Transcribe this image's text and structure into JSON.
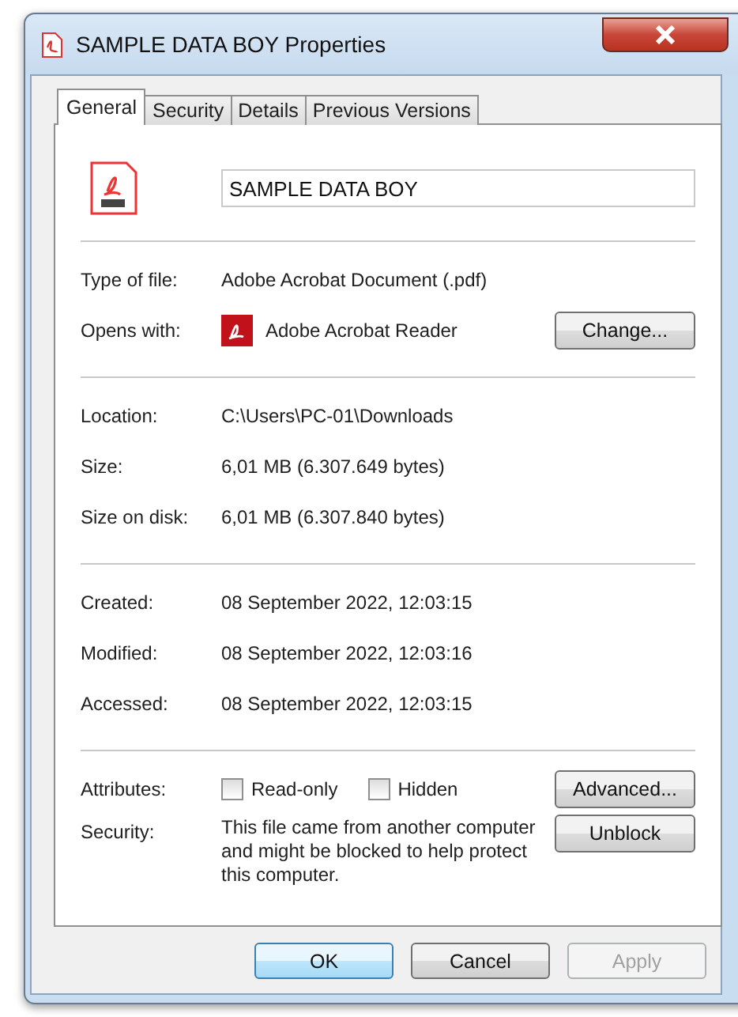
{
  "window": {
    "title": "SAMPLE DATA BOY Properties"
  },
  "tabs": [
    {
      "label": "General",
      "selected": true
    },
    {
      "label": "Security",
      "selected": false
    },
    {
      "label": "Details",
      "selected": false
    },
    {
      "label": "Previous Versions",
      "selected": false
    }
  ],
  "file_name": {
    "value": "SAMPLE DATA BOY"
  },
  "groups": [
    [
      {
        "kind": "text",
        "label": "Type of file:",
        "value": "Adobe Acrobat Document (.pdf)"
      },
      {
        "kind": "app",
        "label": "Opens with:",
        "value": "Adobe Acrobat Reader",
        "button": "Change..."
      }
    ],
    [
      {
        "kind": "text",
        "label": "Location:",
        "value": "C:\\Users\\PC-01\\Downloads"
      },
      {
        "kind": "text",
        "label": "Size:",
        "value": "6,01 MB (6.307.649 bytes)"
      },
      {
        "kind": "text",
        "label": "Size on disk:",
        "value": "6,01 MB (6.307.840 bytes)"
      }
    ],
    [
      {
        "kind": "text",
        "label": "Created:",
        "value": "08 September 2022, 12:03:15"
      },
      {
        "kind": "text",
        "label": "Modified:",
        "value": "08 September 2022, 12:03:16"
      },
      {
        "kind": "text",
        "label": "Accessed:",
        "value": "08 September 2022, 12:03:15"
      }
    ],
    [
      {
        "kind": "checkboxes",
        "label": "Attributes:",
        "options": [
          {
            "label": "Read-only",
            "checked": false
          },
          {
            "label": "Hidden",
            "checked": false
          }
        ],
        "button": "Advanced..."
      },
      {
        "kind": "note",
        "label": "Security:",
        "value": "This file came from another computer and might be blocked to help protect this computer.",
        "button": "Unblock"
      }
    ]
  ],
  "buttons": [
    {
      "label": "OK",
      "default": true,
      "disabled": false
    },
    {
      "label": "Cancel",
      "default": false,
      "disabled": false
    },
    {
      "label": "Apply",
      "default": false,
      "disabled": true
    }
  ]
}
